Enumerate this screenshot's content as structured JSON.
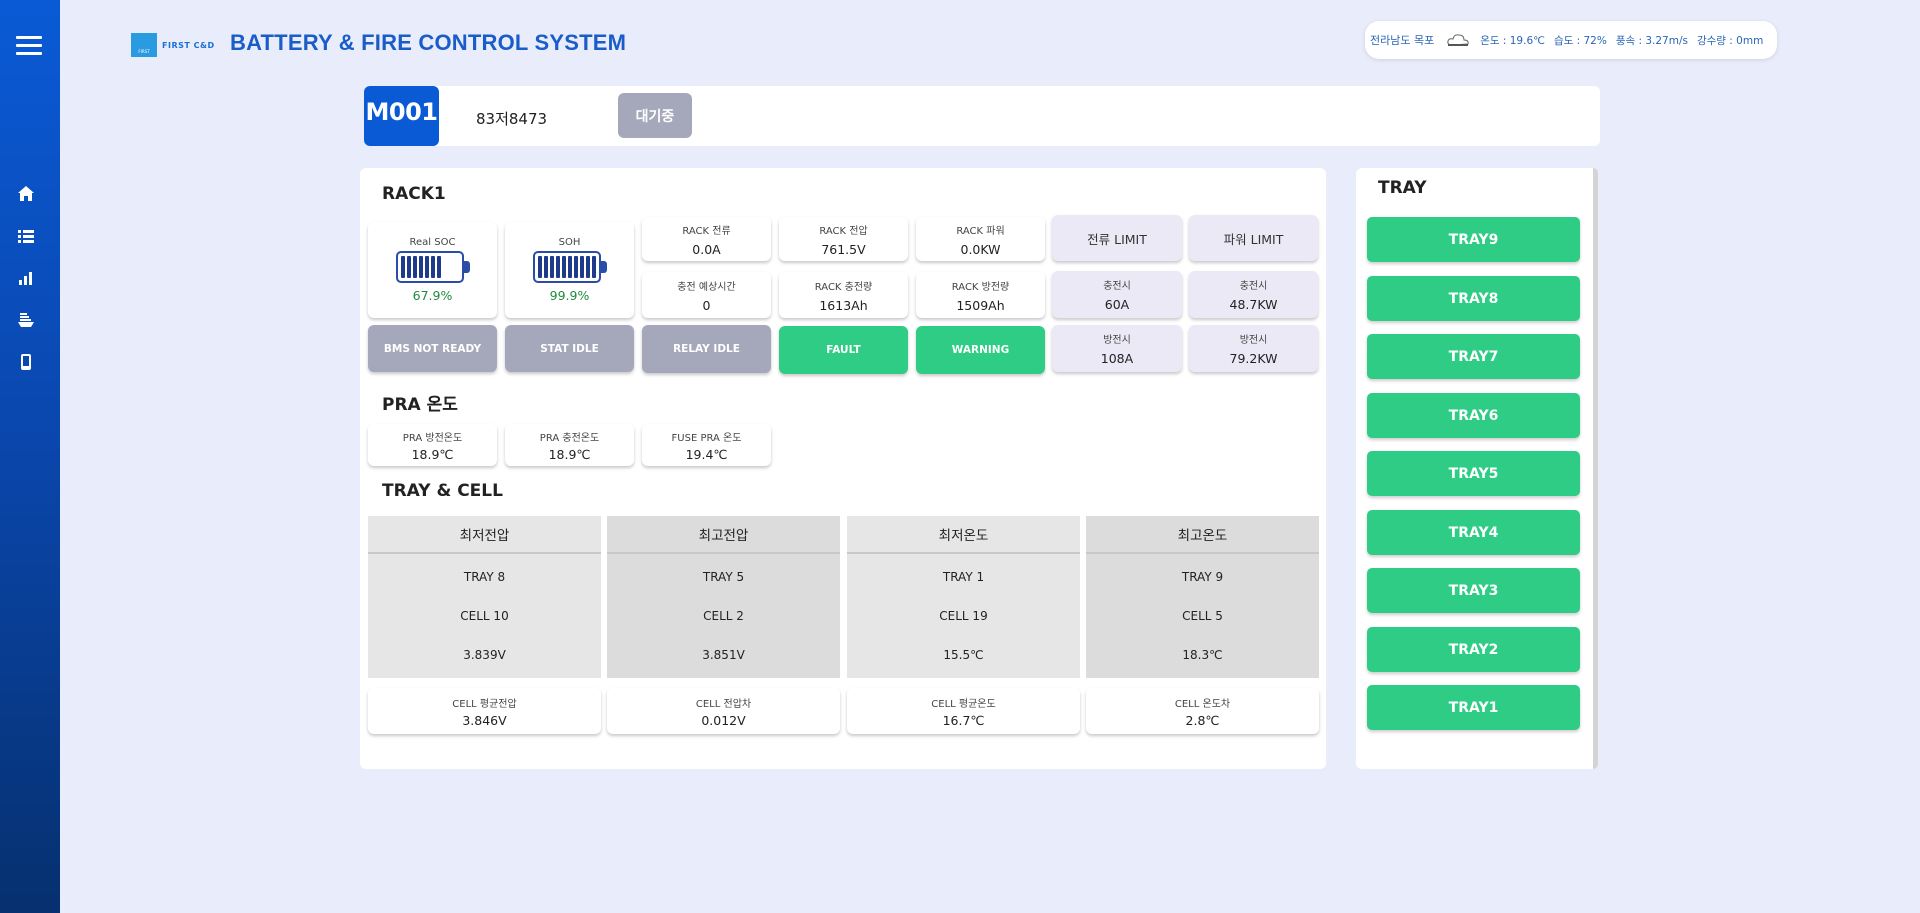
{
  "header": {
    "logo_text": "FIRST C&D",
    "logo_mark_text": "FIRST",
    "title": "BATTERY & FIRE CONTROL SYSTEM"
  },
  "weather": {
    "region": "전라남도 목포",
    "icon": "cloud-icon",
    "temperature": "온도 : 19.6℃",
    "humidity": "습도 : 72%",
    "wind": "풍속 : 3.27m/s",
    "rain": "강수량 : 0mm"
  },
  "sidebar": {
    "items": [
      {
        "icon": "home-icon"
      },
      {
        "icon": "list-icon"
      },
      {
        "icon": "chart-icon"
      },
      {
        "icon": "ship-icon"
      },
      {
        "icon": "mobile-icon"
      }
    ]
  },
  "unit": {
    "id": "M001",
    "code": "83저8473",
    "status": "대기중"
  },
  "rack": {
    "title": "RACK1",
    "real_soc": {
      "label": "Real SOC",
      "value": "67.9%"
    },
    "soh": {
      "label": "SOH",
      "value": "99.9%"
    },
    "metrics": [
      {
        "label": "RACK 전류",
        "value": "0.0A"
      },
      {
        "label": "RACK 전압",
        "value": "761.5V"
      },
      {
        "label": "RACK 파워",
        "value": "0.0KW"
      },
      {
        "label": "충전 예상시간",
        "value": "0"
      },
      {
        "label": "RACK 충전량",
        "value": "1613Ah"
      },
      {
        "label": "RACK 방전량",
        "value": "1509Ah"
      }
    ],
    "limits": {
      "current_header": "전류 LIMIT",
      "power_header": "파워 LIMIT",
      "current_charge": {
        "label": "충전시",
        "value": "60A"
      },
      "power_charge": {
        "label": "충전시",
        "value": "48.7KW"
      },
      "current_discharge": {
        "label": "방전시",
        "value": "108A"
      },
      "power_discharge": {
        "label": "방전시",
        "value": "79.2KW"
      }
    },
    "status": {
      "bms": "BMS NOT READY",
      "stat": "STAT IDLE",
      "relay": "RELAY IDLE",
      "fault": "FAULT",
      "warning": "WARNING"
    }
  },
  "pra": {
    "title": "PRA 온도",
    "items": [
      {
        "label": "PRA 방전온도",
        "value": "18.9℃"
      },
      {
        "label": "PRA 충전온도",
        "value": "18.9℃"
      },
      {
        "label": "FUSE PRA 온도",
        "value": "19.4℃"
      }
    ]
  },
  "tray_cell": {
    "title": "TRAY & CELL",
    "columns": [
      {
        "header": "최저전압",
        "tray": "TRAY 8",
        "cell": "CELL 10",
        "value": "3.839V"
      },
      {
        "header": "최고전압",
        "tray": "TRAY 5",
        "cell": "CELL 2",
        "value": "3.851V"
      },
      {
        "header": "최저온도",
        "tray": "TRAY 1",
        "cell": "CELL 19",
        "value": "15.5℃"
      },
      {
        "header": "최고온도",
        "tray": "TRAY 9",
        "cell": "CELL 5",
        "value": "18.3℃"
      }
    ],
    "summary": [
      {
        "label": "CELL 평균전압",
        "value": "3.846V"
      },
      {
        "label": "CELL 전압차",
        "value": "0.012V"
      },
      {
        "label": "CELL 평균온도",
        "value": "16.7℃"
      },
      {
        "label": "CELL 온도차",
        "value": "2.8℃"
      }
    ]
  },
  "tray_panel": {
    "title": "TRAY",
    "buttons": [
      "TRAY9",
      "TRAY8",
      "TRAY7",
      "TRAY6",
      "TRAY5",
      "TRAY4",
      "TRAY3",
      "TRAY2",
      "TRAY1"
    ]
  },
  "colors": {
    "primary": "#0a5ad6",
    "green": "#2ecc85",
    "gray": "#a4a8ba",
    "soc_green": "#1f8a3a",
    "background": "#e9edfb"
  }
}
